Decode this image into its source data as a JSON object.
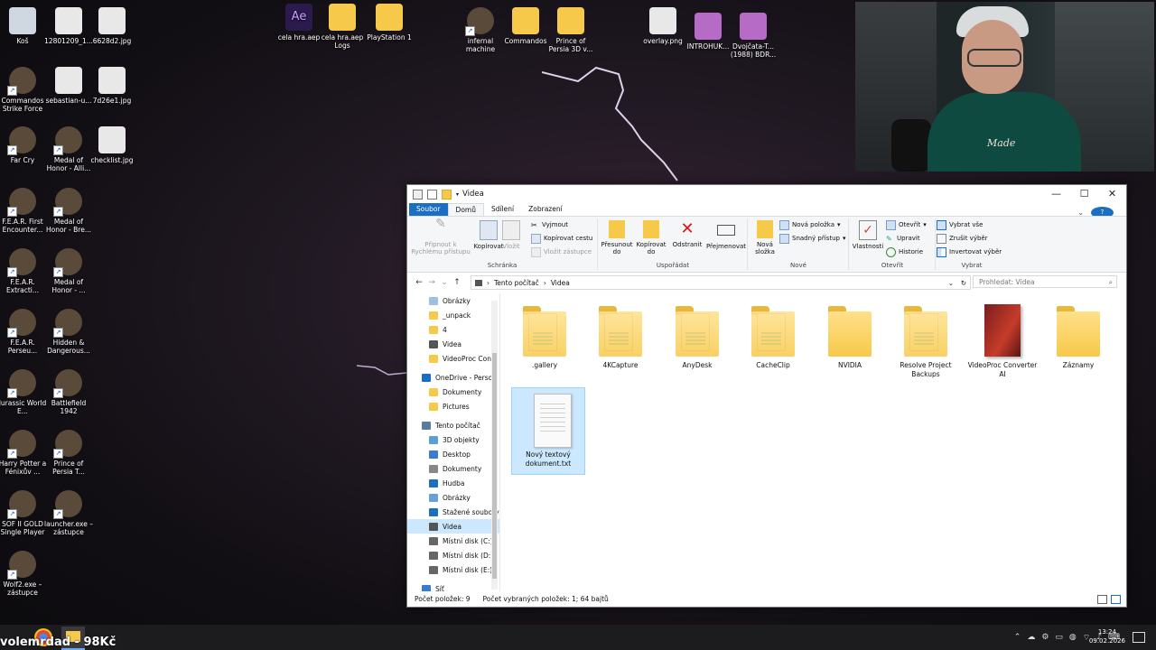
{
  "desktop": {
    "icons": [
      {
        "label": "Koš",
        "icon": "recycle-bin-icon"
      },
      {
        "label": "12801209_1...",
        "icon": "image-file-icon"
      },
      {
        "label": "6628d2.jpg",
        "icon": "image-file-icon"
      },
      {
        "label": "cela hra.aep",
        "icon": "after-effects-icon"
      },
      {
        "label": "cela hra.aep Logs",
        "icon": "folder-icon"
      },
      {
        "label": "PlayStation 1",
        "icon": "folder-icon"
      },
      {
        "label": "infernal machine",
        "icon": "game-icon"
      },
      {
        "label": "Commandos",
        "icon": "folder-icon"
      },
      {
        "label": "Prince of Persia 3D v...",
        "icon": "folder-icon"
      },
      {
        "label": "overlay.png",
        "icon": "image-file-icon"
      },
      {
        "label": "INTROHUK...",
        "icon": "video-file-icon"
      },
      {
        "label": "Dvojčata-T... (1988) BDR...",
        "icon": "video-file-icon"
      },
      {
        "label": "Commandos Strike Force",
        "icon": "game-icon"
      },
      {
        "label": "sebastian-u...",
        "icon": "image-file-icon"
      },
      {
        "label": "7d26e1.jpg",
        "icon": "image-file-icon"
      },
      {
        "label": "Far Cry",
        "icon": "game-icon"
      },
      {
        "label": "Medal of Honor - Alli...",
        "icon": "game-icon"
      },
      {
        "label": "checklist.jpg",
        "icon": "image-file-icon"
      },
      {
        "label": "F.E.A.R. First Encounter...",
        "icon": "game-icon"
      },
      {
        "label": "Medal of Honor - Bre...",
        "icon": "game-icon"
      },
      {
        "label": "F.E.A.R. Extracti...",
        "icon": "game-icon"
      },
      {
        "label": "Medal of Honor - ...",
        "icon": "game-icon"
      },
      {
        "label": "F.E.A.R. Perseu...",
        "icon": "game-icon"
      },
      {
        "label": "Hidden & Dangerous...",
        "icon": "game-icon"
      },
      {
        "label": "Jurassic World E...",
        "icon": "game-icon"
      },
      {
        "label": "Battlefield 1942",
        "icon": "game-icon"
      },
      {
        "label": "Harry Potter a Fénixův ...",
        "icon": "game-icon"
      },
      {
        "label": "Prince of Persia T...",
        "icon": "game-icon"
      },
      {
        "label": "SOF II GOLD Single Player",
        "icon": "game-icon"
      },
      {
        "label": "launcher.exe – zástupce",
        "icon": "game-icon"
      },
      {
        "label": "Wolf2.exe – zástupce",
        "icon": "game-icon"
      }
    ]
  },
  "webcam": {
    "shirt_text": "Made"
  },
  "explorer": {
    "title": "Videa",
    "tabs": [
      "Soubor",
      "Domů",
      "Sdílení",
      "Zobrazení"
    ],
    "ribbon": {
      "pin": "Připnout k Rychlému přístupu",
      "copy": "Kopírovat",
      "paste": "Vložit",
      "cut": "Vyjmout",
      "copy_path": "Kopírovat cestu",
      "paste_shortcut": "Vložit zástupce",
      "group_clipboard": "Schránka",
      "move_to": "Přesunout do",
      "copy_to": "Kopírovat do",
      "delete": "Odstranit",
      "rename": "Přejmenovat",
      "group_organize": "Uspořádat",
      "new_folder": "Nová složka",
      "new_item": "Nová položka",
      "easy_access": "Snadný přístup",
      "group_new": "Nové",
      "properties": "Vlastnosti",
      "open": "Otevřít",
      "edit": "Upravit",
      "history": "Historie",
      "group_open": "Otevřít",
      "select_all": "Vybrat vše",
      "select_none": "Zrušit výběr",
      "invert_selection": "Invertovat výběr",
      "group_select": "Vybrat"
    },
    "breadcrumb": [
      "Tento počítač",
      "Videa"
    ],
    "search_placeholder": "Prohledat: Videa",
    "nav_items": [
      {
        "label": "Obrázky",
        "type": "pinned",
        "sel": false
      },
      {
        "label": "_unpack",
        "type": "folder",
        "sel": false
      },
      {
        "label": "4",
        "type": "folder",
        "sel": false
      },
      {
        "label": "Videa",
        "type": "video",
        "sel": false
      },
      {
        "label": "VideoProc Conv",
        "type": "folder",
        "sel": false
      },
      {
        "label": "OneDrive - Persor",
        "type": "cloud",
        "sel": false
      },
      {
        "label": "Dokumenty",
        "type": "folder",
        "sel": false
      },
      {
        "label": "Pictures",
        "type": "folder",
        "sel": false
      },
      {
        "label": "Tento počítač",
        "type": "pc",
        "sel": false
      },
      {
        "label": "3D objekty",
        "type": "3d",
        "sel": false
      },
      {
        "label": "Desktop",
        "type": "desktop",
        "sel": false
      },
      {
        "label": "Dokumenty",
        "type": "docs",
        "sel": false
      },
      {
        "label": "Hudba",
        "type": "music",
        "sel": false
      },
      {
        "label": "Obrázky",
        "type": "pics",
        "sel": false
      },
      {
        "label": "Stažené soubory",
        "type": "download",
        "sel": false
      },
      {
        "label": "Videa",
        "type": "video",
        "sel": true
      },
      {
        "label": "Místní disk (C:)",
        "type": "drive",
        "sel": false
      },
      {
        "label": "Místní disk (D:)",
        "type": "drive",
        "sel": false
      },
      {
        "label": "Místní disk (E:)",
        "type": "drive",
        "sel": false
      },
      {
        "label": "Síť",
        "type": "network",
        "sel": false
      }
    ],
    "files": [
      {
        "name": ".gallery",
        "kind": "folder-doc"
      },
      {
        "name": "4KCapture",
        "kind": "folder-doc"
      },
      {
        "name": "AnyDesk",
        "kind": "folder-doc"
      },
      {
        "name": "CacheClip",
        "kind": "folder-doc"
      },
      {
        "name": "NVIDIA",
        "kind": "folder"
      },
      {
        "name": "Resolve Project Backups",
        "kind": "folder-doc"
      },
      {
        "name": "VideoProc Converter AI",
        "kind": "product"
      },
      {
        "name": "Záznamy",
        "kind": "folder"
      },
      {
        "name": "Nový textový dokument.txt",
        "kind": "txt"
      }
    ],
    "status_count": "Počet položek: 9",
    "status_selected": "Počet vybraných položek: 1; 64 bajtů"
  },
  "taskbar": {
    "overlay_text": "volemrdad - 98Kč",
    "time": "13:24",
    "date": "09.02.2026"
  },
  "colors": {
    "accent": "#1a6ec4",
    "selection": "#cce8ff",
    "folder": "#f7c94a"
  }
}
